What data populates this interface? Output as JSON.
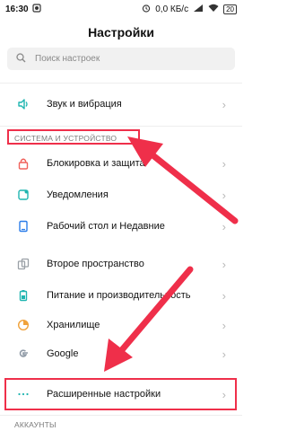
{
  "status_bar": {
    "time": "16:30",
    "speed": "0,0 КБ/с",
    "battery": "20"
  },
  "header": {
    "title": "Настройки"
  },
  "search": {
    "placeholder": "Поиск настроек"
  },
  "items_top": [
    {
      "label": "Звук и вибрация",
      "icon": "speaker-icon"
    }
  ],
  "section_system": {
    "label": "СИСТЕМА И УСТРОЙСТВО"
  },
  "items_system": [
    {
      "label": "Блокировка и защита",
      "icon": "lock-icon"
    },
    {
      "label": "Уведомления",
      "icon": "notifications-icon"
    },
    {
      "label": "Рабочий стол и Недавние",
      "icon": "home-screen-icon"
    },
    {
      "label": "Второе пространство",
      "icon": "second-space-icon"
    },
    {
      "label": "Питание и производительность",
      "icon": "battery-icon"
    },
    {
      "label": "Хранилище",
      "icon": "storage-icon"
    },
    {
      "label": "Google",
      "icon": "google-icon"
    },
    {
      "label": "Расширенные настройки",
      "icon": "more-dots-icon"
    }
  ],
  "section_accounts": {
    "label": "АККАУНТЫ"
  },
  "chevron": "›",
  "colors": {
    "accent": "#1fb5b0",
    "annotation": "#ef2f4a"
  }
}
